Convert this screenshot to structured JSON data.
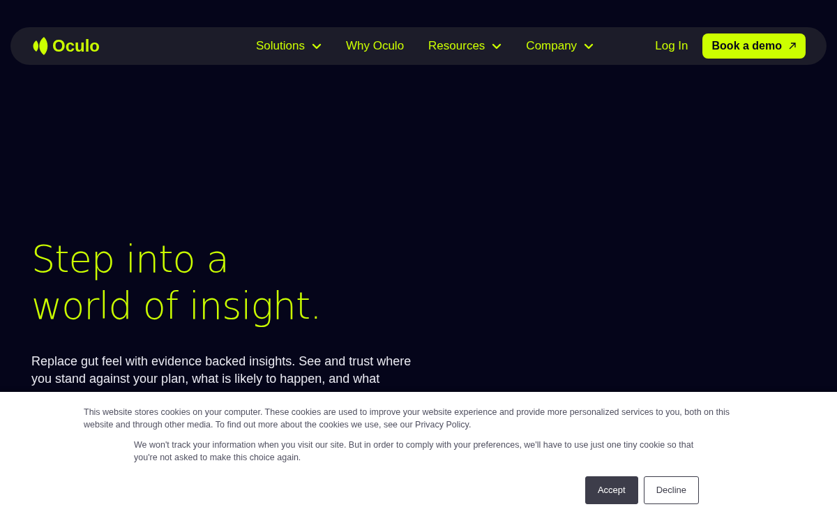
{
  "navbar": {
    "logo": "Oculo",
    "menu": [
      {
        "label": "Solutions",
        "dropdown": true
      },
      {
        "label": "Why Oculo",
        "dropdown": false
      },
      {
        "label": "Resources",
        "dropdown": true
      },
      {
        "label": "Company",
        "dropdown": true
      }
    ],
    "login": "Log In",
    "cta": "Book a demo"
  },
  "hero": {
    "heading_lines": [
      "Step into a",
      "world of insight."
    ],
    "text": "Replace gut feel with evidence backed insights. See and trust where you stand against your plan, what is likely to happen, and what"
  },
  "cookie_banner": {
    "notice": "This website stores cookies on your computer. These cookies are used to improve your website experience and provide more personalized services to you, both on this website and through other media. To find out more about the cookies we use, see our Privacy Policy.",
    "decline_note": "We won't track your information when you visit our site. But in order to comply with your preferences, we'll have to use just one tiny cookie so that you're not asked to make this choice again.",
    "buttons": [
      {
        "label": "Accept",
        "kind": "primary"
      },
      {
        "label": "Decline",
        "kind": "outline"
      }
    ]
  }
}
